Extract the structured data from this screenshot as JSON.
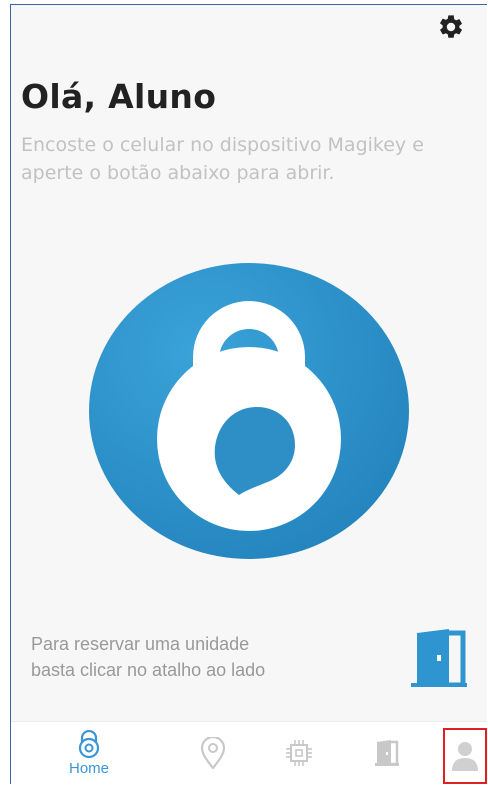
{
  "header": {
    "settings_icon": "gear-icon",
    "greeting": "Olá, Aluno",
    "instructions": "Encoste o celular no dispositivo Magikey e aperte o botão abaixo para abrir."
  },
  "unlock": {
    "icon": "padlock-icon",
    "colors": {
      "circle": "#2e8fc6",
      "circle_light": "#3aa3d8",
      "lock": "#ffffff"
    }
  },
  "reserve": {
    "hint_line1": "Para reservar uma unidade",
    "hint_line2": "basta clicar no atalho ao lado",
    "icon": "door-icon",
    "color": "#2e95d0"
  },
  "bottom_nav": {
    "items": [
      {
        "id": "home",
        "label": "Home",
        "icon": "magikey-logo-icon",
        "active": true
      },
      {
        "id": "location",
        "icon": "location-pin-icon",
        "active": false
      },
      {
        "id": "devices",
        "icon": "chip-icon",
        "active": false
      },
      {
        "id": "units",
        "icon": "door-icon",
        "active": false
      },
      {
        "id": "profile",
        "icon": "user-icon",
        "active": false
      }
    ],
    "active_color": "#3a96d6",
    "inactive_color": "#c8c8c8",
    "highlight_color": "#e02020"
  }
}
